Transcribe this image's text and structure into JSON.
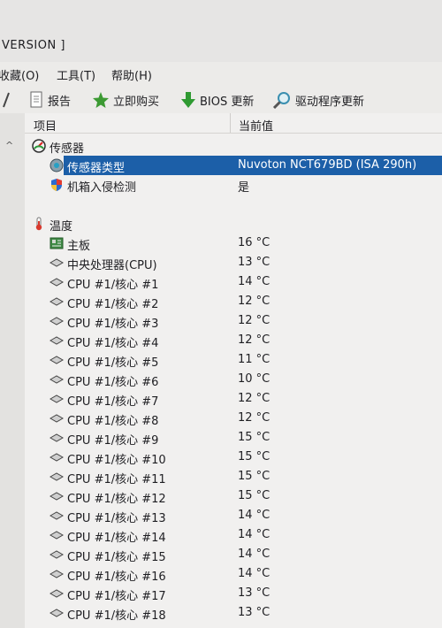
{
  "window": {
    "title": "VERSION ]"
  },
  "menu": [
    {
      "label": "收藏(O)"
    },
    {
      "label": "工具(T)"
    },
    {
      "label": "帮助(H)"
    }
  ],
  "toolbar": {
    "report": "报告",
    "buy": "立即购买",
    "bios": "BIOS 更新",
    "driver": "驱动程序更新"
  },
  "columns": {
    "item": "项目",
    "value": "当前值"
  },
  "sensors": {
    "group": "传感器",
    "type_label": "传感器类型",
    "type_value": "Nuvoton NCT679BD  (ISA 290h)",
    "intrusion_label": "机箱入侵检测",
    "intrusion_value": "是"
  },
  "temperature": {
    "group": "温度",
    "rows": [
      {
        "label": "主板",
        "value": "16 °C"
      },
      {
        "label": "中央处理器(CPU)",
        "value": "13 °C"
      },
      {
        "label": "CPU #1/核心 #1",
        "value": "14 °C"
      },
      {
        "label": "CPU #1/核心 #2",
        "value": "12 °C"
      },
      {
        "label": "CPU #1/核心 #3",
        "value": "12 °C"
      },
      {
        "label": "CPU #1/核心 #4",
        "value": "12 °C"
      },
      {
        "label": "CPU #1/核心 #5",
        "value": "11 °C"
      },
      {
        "label": "CPU #1/核心 #6",
        "value": "10 °C"
      },
      {
        "label": "CPU #1/核心 #7",
        "value": "12 °C"
      },
      {
        "label": "CPU #1/核心 #8",
        "value": "12 °C"
      },
      {
        "label": "CPU #1/核心 #9",
        "value": "15 °C"
      },
      {
        "label": "CPU #1/核心 #10",
        "value": "15 °C"
      },
      {
        "label": "CPU #1/核心 #11",
        "value": "15 °C"
      },
      {
        "label": "CPU #1/核心 #12",
        "value": "15 °C"
      },
      {
        "label": "CPU #1/核心 #13",
        "value": "14 °C"
      },
      {
        "label": "CPU #1/核心 #14",
        "value": "14 °C"
      },
      {
        "label": "CPU #1/核心 #15",
        "value": "14 °C"
      },
      {
        "label": "CPU #1/核心 #16",
        "value": "14 °C"
      },
      {
        "label": "CPU #1/核心 #17",
        "value": "13 °C"
      },
      {
        "label": "CPU #1/核心 #18",
        "value": "13 °C"
      }
    ]
  }
}
